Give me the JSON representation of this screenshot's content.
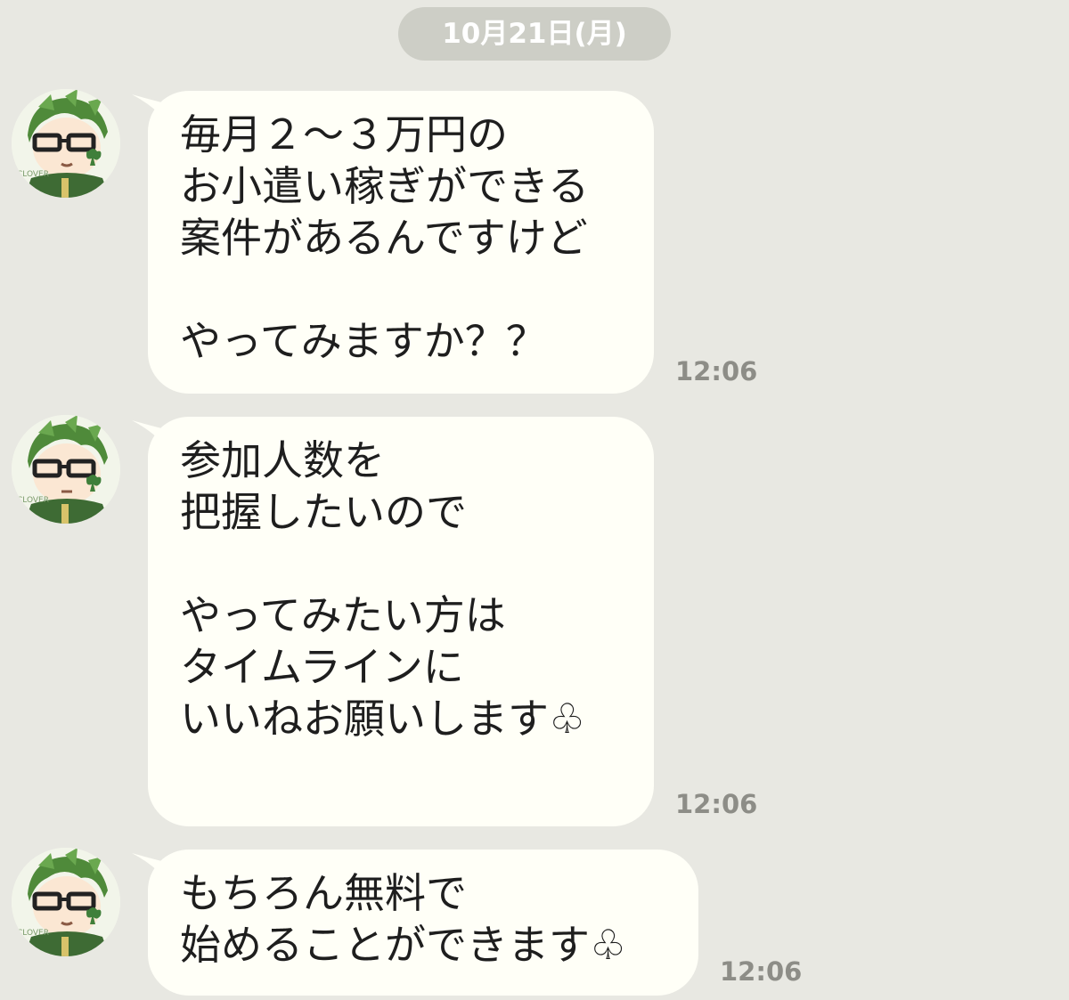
{
  "date_separator": "10月21日(月)",
  "messages": [
    {
      "avatar_icon": "character-avatar-icon",
      "lines": [
        "毎月２〜３万円の",
        "お小遣い稼ぎができる",
        "案件があるんですけど",
        "",
        "やってみますか？？"
      ],
      "time": "12:06"
    },
    {
      "avatar_icon": "character-avatar-icon",
      "lines": [
        "参加人数を",
        "把握したいので",
        "",
        "やってみたい方は",
        "タイムラインに",
        "いいねお願いします♧"
      ],
      "time": "12:06"
    },
    {
      "avatar_icon": "character-avatar-icon",
      "lines": [
        "もちろん無料で",
        "始めることができます♧"
      ],
      "time": "12:06"
    }
  ],
  "avatar_text": "CLOVER",
  "colors": {
    "background": "#e8e8e2",
    "bubble": "#fffff7",
    "date_pill": "#cdcec6",
    "timestamp": "#8d8d87",
    "avatar_hair": "#4f8a3a"
  }
}
